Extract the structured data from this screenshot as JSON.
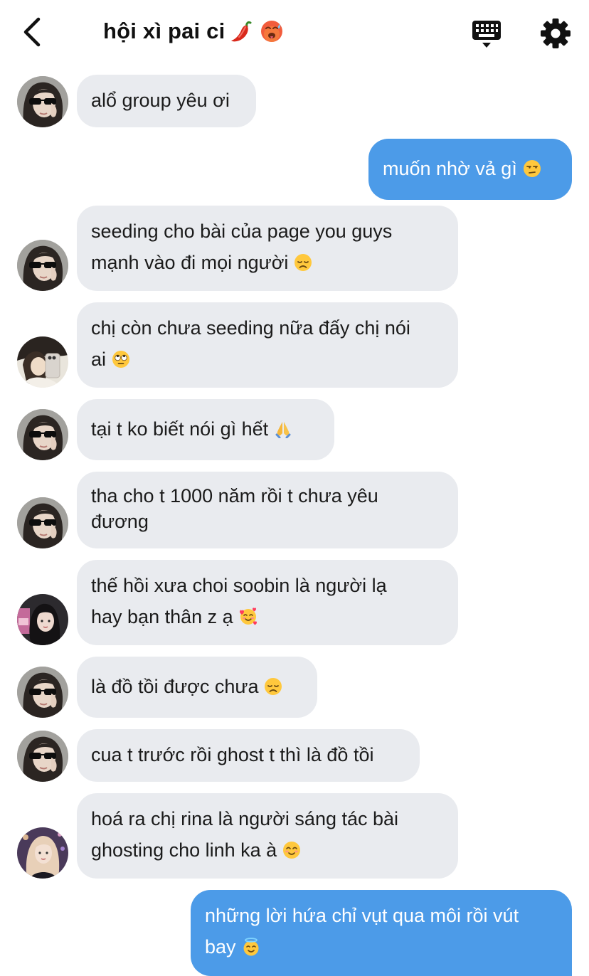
{
  "header": {
    "back_icon": "chevron-left-icon",
    "title": "hội xì pai ci",
    "title_emojis": [
      "chili-pepper-emoji",
      "hot-face-emoji"
    ],
    "keyboard_icon": "keyboard-icon",
    "settings_icon": "gear-icon"
  },
  "messages": [
    {
      "side": "in",
      "avatar": "avatar-sunglasses",
      "lines": [
        "alổ group yêu ơi"
      ]
    },
    {
      "side": "out",
      "lines": [
        "muốn nhờ vả gì"
      ],
      "emoji": "unamused-face"
    },
    {
      "side": "in",
      "avatar": "avatar-sunglasses",
      "lines": [
        "seeding cho bài của page you guys",
        "mạnh vào đi mọi người"
      ],
      "emoji": "disappointed-face"
    },
    {
      "side": "in",
      "avatar": "avatar-phone-selfie",
      "lines": [
        "chị còn chưa seeding nữa đấy chị nói",
        "ai"
      ],
      "emoji": "eye-roll-face"
    },
    {
      "side": "in",
      "avatar": "avatar-sunglasses",
      "lines": [
        "tại t ko biết nói gì hết"
      ],
      "emoji": "folded-hands"
    },
    {
      "side": "in",
      "avatar": "avatar-sunglasses",
      "lines": [
        "tha cho t 1000 năm rồi t chưa yêu",
        "đương"
      ]
    },
    {
      "side": "in",
      "avatar": "avatar-dark-hair",
      "lines": [
        "thế hồi xưa choi soobin là người lạ",
        "hay bạn thân z ạ"
      ],
      "emoji": "smiling-face-hearts"
    },
    {
      "side": "in",
      "avatar": "avatar-sunglasses",
      "lines": [
        "là đồ tồi được chưa"
      ],
      "emoji": "disappointed-face"
    },
    {
      "side": "in",
      "avatar": "avatar-sunglasses",
      "lines": [
        "cua t trước rồi ghost t thì là đồ tồi"
      ]
    },
    {
      "side": "in",
      "avatar": "avatar-blonde",
      "lines": [
        "hoá ra chị rina là người sáng tác bài",
        "ghosting cho linh ka à"
      ],
      "emoji": "smiling-face"
    },
    {
      "side": "out",
      "lines": [
        "những lời hứa chỉ vụt qua môi rồi vút",
        "bay"
      ],
      "emoji": "halo-face"
    }
  ],
  "colors": {
    "incoming_bubble": "#e9ebef",
    "outgoing_bubble": "#4c9be8",
    "text": "#1b1b1b"
  }
}
